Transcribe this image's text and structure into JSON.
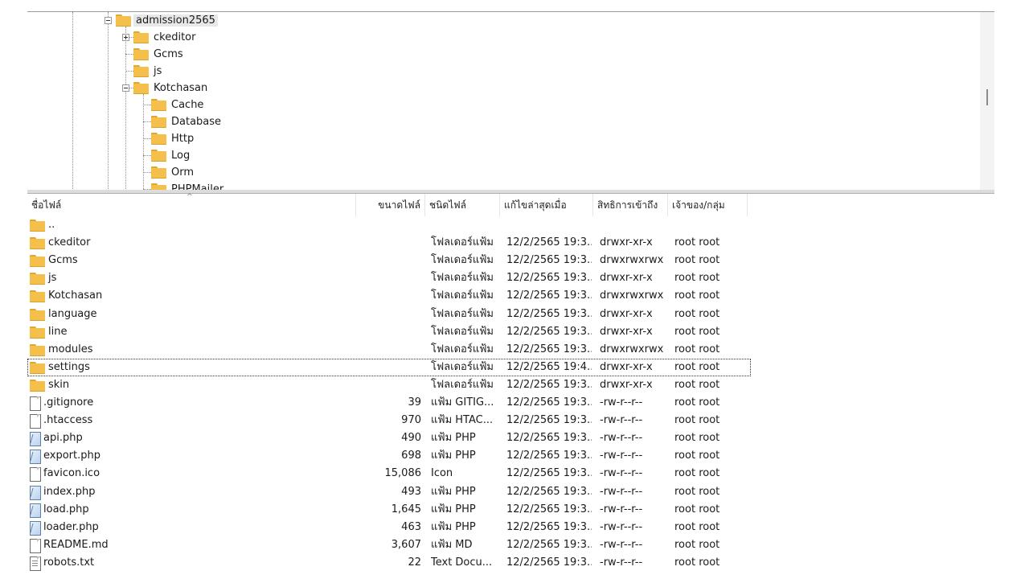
{
  "tree": {
    "nodes": [
      {
        "label": "admission2565",
        "expander": "minus"
      },
      {
        "label": "ckeditor",
        "expander": "plus"
      },
      {
        "label": "Gcms",
        "expander": ""
      },
      {
        "label": "js",
        "expander": ""
      },
      {
        "label": "Kotchasan",
        "expander": "minus"
      },
      {
        "label": "Cache",
        "expander": ""
      },
      {
        "label": "Database",
        "expander": ""
      },
      {
        "label": "Http",
        "expander": ""
      },
      {
        "label": "Log",
        "expander": ""
      },
      {
        "label": "Orm",
        "expander": ""
      },
      {
        "label": "PHPMailer",
        "expander": ""
      }
    ]
  },
  "list": {
    "headers": {
      "name": "ชื่อไฟล์",
      "size": "ขนาดไฟล์",
      "type": "ชนิดไฟล์",
      "modified": "แก้ไขล่าสุดเมื่อ",
      "perm": "สิทธิการเข้าถึง",
      "owner": "เจ้าของ/กลุ่ม"
    },
    "rows": [
      {
        "name": "..",
        "icon": "folder-icon",
        "size": "",
        "type": "",
        "modified": "",
        "perm": "",
        "owner": ""
      },
      {
        "name": "ckeditor",
        "icon": "folder-icon",
        "size": "",
        "type": "โฟลเดอร์แฟ้ม",
        "modified": "12/2/2565 19:3...",
        "perm": "drwxr-xr-x",
        "owner": "root root"
      },
      {
        "name": "Gcms",
        "icon": "folder-icon",
        "size": "",
        "type": "โฟลเดอร์แฟ้ม",
        "modified": "12/2/2565 19:3...",
        "perm": "drwxrwxrwx",
        "owner": "root root"
      },
      {
        "name": "js",
        "icon": "folder-icon",
        "size": "",
        "type": "โฟลเดอร์แฟ้ม",
        "modified": "12/2/2565 19:3...",
        "perm": "drwxr-xr-x",
        "owner": "root root"
      },
      {
        "name": "Kotchasan",
        "icon": "folder-icon",
        "size": "",
        "type": "โฟลเดอร์แฟ้ม",
        "modified": "12/2/2565 19:3...",
        "perm": "drwxrwxrwx",
        "owner": "root root"
      },
      {
        "name": "language",
        "icon": "folder-icon",
        "size": "",
        "type": "โฟลเดอร์แฟ้ม",
        "modified": "12/2/2565 19:3...",
        "perm": "drwxr-xr-x",
        "owner": "root root"
      },
      {
        "name": "line",
        "icon": "folder-icon",
        "size": "",
        "type": "โฟลเดอร์แฟ้ม",
        "modified": "12/2/2565 19:3...",
        "perm": "drwxr-xr-x",
        "owner": "root root"
      },
      {
        "name": "modules",
        "icon": "folder-icon",
        "size": "",
        "type": "โฟลเดอร์แฟ้ม",
        "modified": "12/2/2565 19:3...",
        "perm": "drwxrwxrwx",
        "owner": "root root"
      },
      {
        "name": "settings",
        "icon": "folder-icon",
        "size": "",
        "type": "โฟลเดอร์แฟ้ม",
        "modified": "12/2/2565 19:4...",
        "perm": "drwxr-xr-x",
        "owner": "root root"
      },
      {
        "name": "skin",
        "icon": "folder-icon",
        "size": "",
        "type": "โฟลเดอร์แฟ้ม",
        "modified": "12/2/2565 19:3...",
        "perm": "drwxr-xr-x",
        "owner": "root root"
      },
      {
        "name": ".gitignore",
        "icon": "file-icon",
        "size": "39",
        "type": "แฟ้ม GITIG...",
        "modified": "12/2/2565 19:3...",
        "perm": "-rw-r--r--",
        "owner": "root root"
      },
      {
        "name": ".htaccess",
        "icon": "file-icon",
        "size": "970",
        "type": "แฟ้ม HTAC...",
        "modified": "12/2/2565 19:3...",
        "perm": "-rw-r--r--",
        "owner": "root root"
      },
      {
        "name": "api.php",
        "icon": "php-file-icon",
        "size": "490",
        "type": "แฟ้ม PHP",
        "modified": "12/2/2565 19:3...",
        "perm": "-rw-r--r--",
        "owner": "root root"
      },
      {
        "name": "export.php",
        "icon": "php-file-icon",
        "size": "698",
        "type": "แฟ้ม PHP",
        "modified": "12/2/2565 19:3...",
        "perm": "-rw-r--r--",
        "owner": "root root"
      },
      {
        "name": "favicon.ico",
        "icon": "file-icon",
        "size": "15,086",
        "type": "Icon",
        "modified": "12/2/2565 19:3...",
        "perm": "-rw-r--r--",
        "owner": "root root"
      },
      {
        "name": "index.php",
        "icon": "php-file-icon",
        "size": "493",
        "type": "แฟ้ม PHP",
        "modified": "12/2/2565 19:3...",
        "perm": "-rw-r--r--",
        "owner": "root root"
      },
      {
        "name": "load.php",
        "icon": "php-file-icon",
        "size": "1,645",
        "type": "แฟ้ม PHP",
        "modified": "12/2/2565 19:3...",
        "perm": "-rw-r--r--",
        "owner": "root root"
      },
      {
        "name": "loader.php",
        "icon": "php-file-icon",
        "size": "463",
        "type": "แฟ้ม PHP",
        "modified": "12/2/2565 19:3...",
        "perm": "-rw-r--r--",
        "owner": "root root"
      },
      {
        "name": "README.md",
        "icon": "file-icon",
        "size": "3,607",
        "type": "แฟ้ม MD",
        "modified": "12/2/2565 19:3...",
        "perm": "-rw-r--r--",
        "owner": "root root"
      },
      {
        "name": "robots.txt",
        "icon": "text-file-icon",
        "size": "22",
        "type": "Text Docu...",
        "modified": "12/2/2565 19:3...",
        "perm": "-rw-r--r--",
        "owner": "root root"
      }
    ]
  }
}
